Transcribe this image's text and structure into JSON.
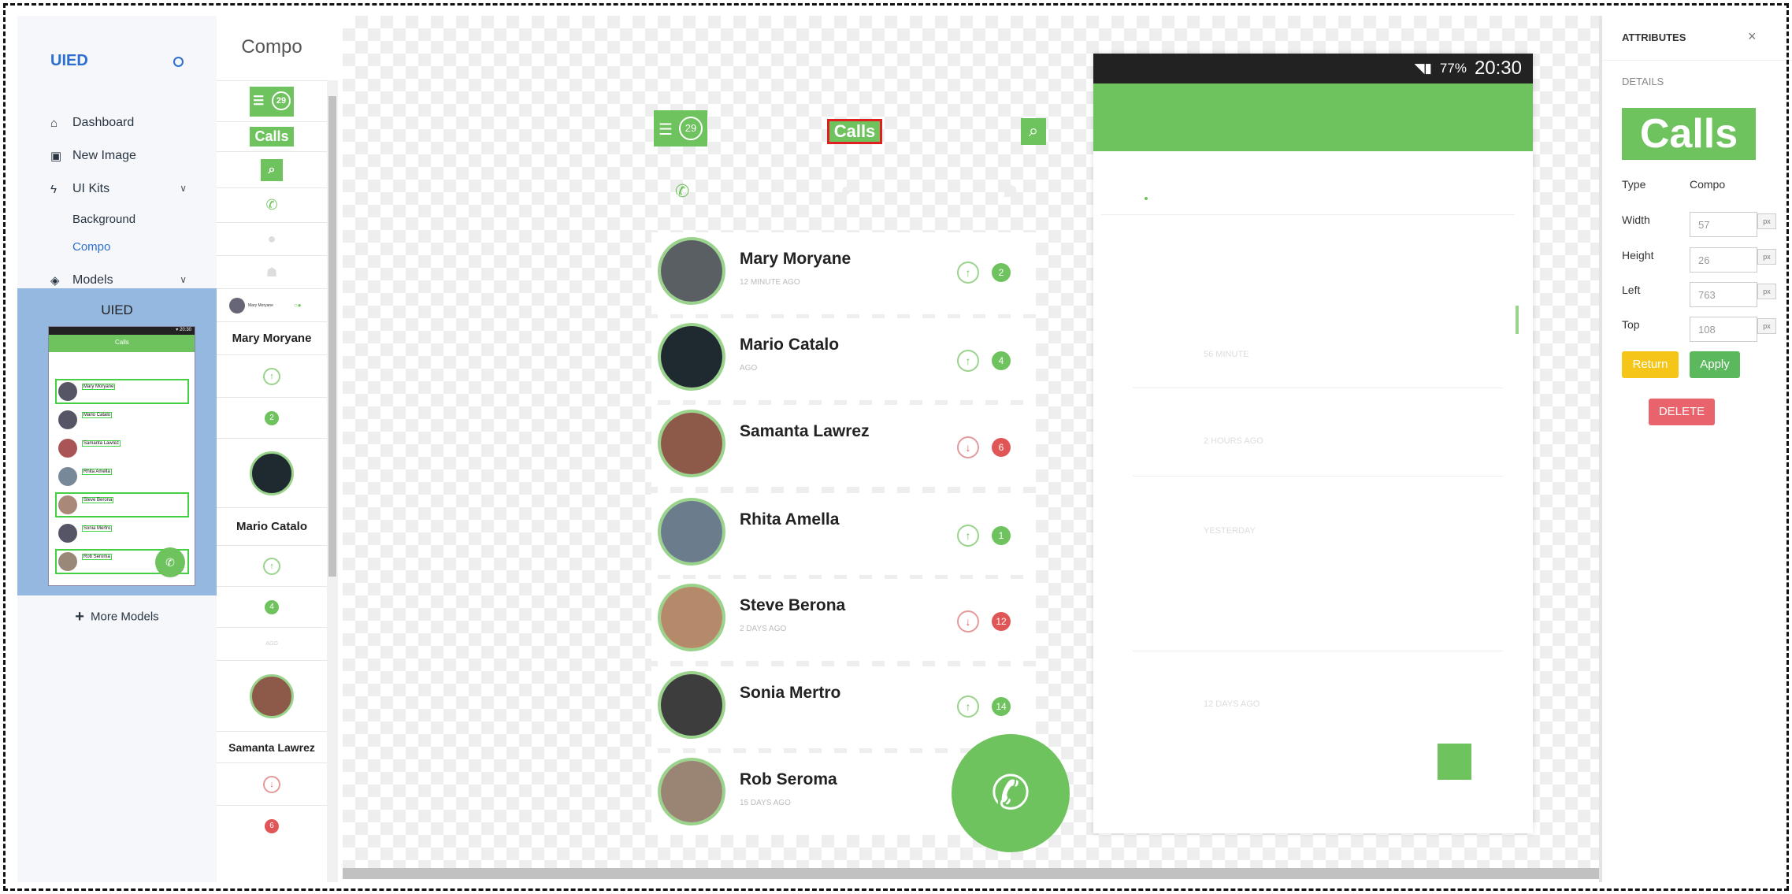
{
  "sidebar": {
    "logo": "UIED",
    "nav": {
      "dashboard": "Dashboard",
      "new_image": "New Image",
      "ui_kits": "UI Kits",
      "background": "Background",
      "compo": "Compo",
      "models": "Models"
    },
    "model_title": "UIED",
    "more_models": "More Models",
    "mini_phone": {
      "title": "Calls",
      "names": [
        "Mary Moryane",
        "Mario Catalo",
        "Samanta Lawrez",
        "Rhita Amella",
        "Steve Berona",
        "Sonia Mertro",
        "Rob Seroma"
      ]
    }
  },
  "compo_panel": {
    "title": "Compo",
    "badge_num": "29",
    "calls_label": "Calls",
    "names": [
      "Mary Moryane",
      "Mario Catalo",
      "Samanta Lawrez"
    ],
    "badges": [
      "2",
      "4",
      "6"
    ],
    "tiny_name": "Mary Moryane",
    "ago": "AGO"
  },
  "canvas": {
    "badge_num": "29",
    "calls_label": "Calls",
    "contacts": [
      {
        "name": "Mary Moryane",
        "time": "12 MINUTE AGO",
        "direction": "up",
        "count": "2",
        "color": "#6fc35e"
      },
      {
        "name": "Mario Catalo",
        "time": "AGO",
        "direction": "up",
        "count": "4",
        "color": "#6fc35e"
      },
      {
        "name": "Samanta Lawrez",
        "time": "",
        "direction": "down",
        "count": "6",
        "color": "#e05555"
      },
      {
        "name": "Rhita Amella",
        "time": "",
        "direction": "up",
        "count": "1",
        "color": "#6fc35e"
      },
      {
        "name": "Steve Berona",
        "time": "2 DAYS AGO",
        "direction": "down",
        "count": "12",
        "color": "#e05555"
      },
      {
        "name": "Sonia Mertro",
        "time": "",
        "direction": "up",
        "count": "14",
        "color": "#6fc35e"
      },
      {
        "name": "Rob Seroma",
        "time": "15 DAYS AGO",
        "direction": "",
        "count": "",
        "color": "#6fc35e"
      }
    ]
  },
  "phone": {
    "status": {
      "battery": "77%",
      "time": "20:30"
    },
    "ghost_times": [
      "56 MINUTE",
      "2 HOURS AGO",
      "YESTERDAY",
      "12 DAYS AGO"
    ]
  },
  "attributes": {
    "title": "ATTRIBUTES",
    "section": "DETAILS",
    "preview_text": "Calls",
    "type_label": "Type",
    "type_value": "Compo",
    "width_label": "Width",
    "width_value": "57",
    "height_label": "Height",
    "height_value": "26",
    "left_label": "Left",
    "left_value": "763",
    "top_label": "Top",
    "top_value": "108",
    "unit": "px",
    "return_label": "Return",
    "apply_label": "Apply",
    "delete_label": "DELETE"
  },
  "colors": {
    "accent": "#6fc35e",
    "brand": "#2c6fcf",
    "danger": "#e05555",
    "return": "#f5c518"
  }
}
